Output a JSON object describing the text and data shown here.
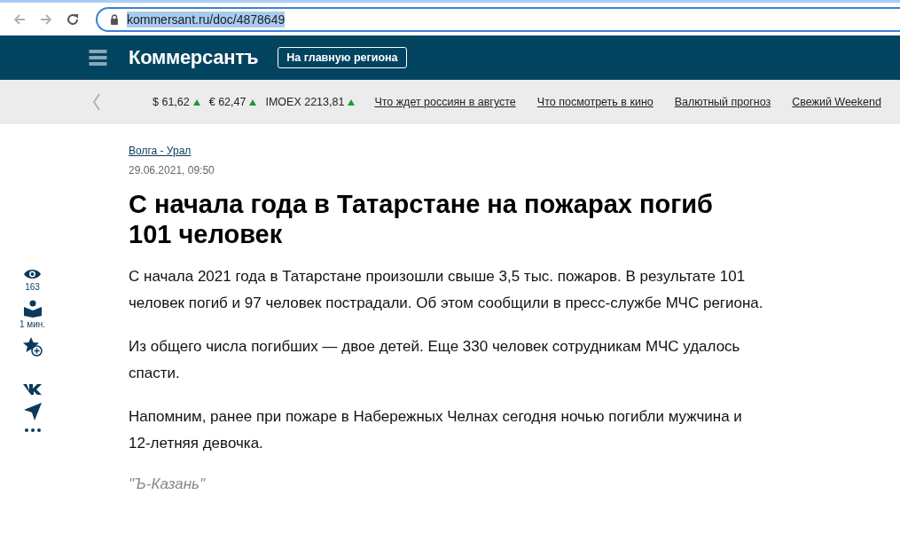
{
  "browser": {
    "url": "kommersant.ru/doc/4878649",
    "url_selected": true
  },
  "header": {
    "logo": "Коммерсантъ",
    "region_button": "На главную региона"
  },
  "ticker": {
    "quotes": [
      {
        "label": "$ 61,62",
        "rising": true
      },
      {
        "label": "€ 62,47",
        "rising": true
      },
      {
        "label": "IMOEX 2213,81",
        "rising": true
      }
    ],
    "links": [
      "Что ждет россиян в августе",
      "Что посмотреть в кино",
      "Валютный прогноз",
      "Свежий Weekend"
    ]
  },
  "article": {
    "section": "Волга - Урал",
    "date": "29.06.2021, 09:50",
    "title": "С начала года в Татарстане на пожарах погиб 101 человек",
    "views": "163",
    "read_time": "1 мин.",
    "paragraphs": [
      "С начала 2021 года в Татарстане произошли свыше 3,5 тыс. пожаров. В результате 101 человек погиб и 97 человек пострадали. Об этом сообщили в пресс-службе МЧС региона.",
      "Из общего числа погибших — двое детей. Еще 330 человек сотрудникам МЧС удалось спасти.",
      "Напомним, ранее при пожаре в Набережных Челнах сегодня ночью погибли мужчина и 12-летняя девочка."
    ],
    "source": "\"Ъ-Казань\""
  }
}
